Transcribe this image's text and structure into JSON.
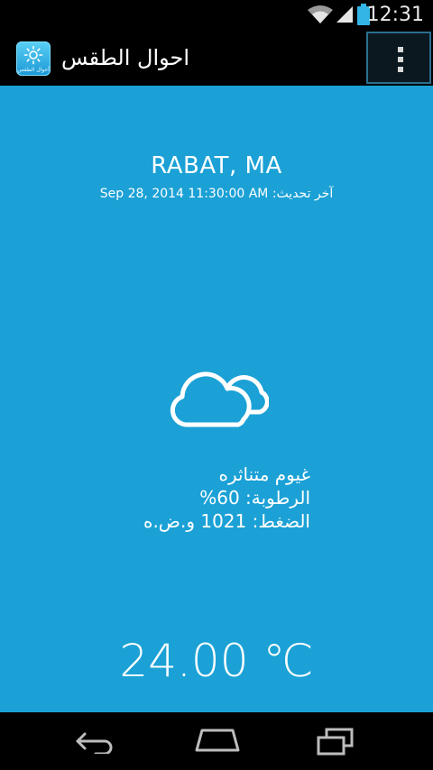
{
  "status_bar": {
    "time": "12:31",
    "icons": [
      "wifi-icon",
      "signal-icon",
      "battery-icon"
    ]
  },
  "action_bar": {
    "app_icon": "weather-app-icon",
    "app_icon_caption": "أحوال الطقس",
    "title": "احوال الطقس",
    "overflow_icon": "overflow-menu-icon"
  },
  "weather": {
    "city": "RABAT, MA",
    "last_update_label": "آخر تحديث:",
    "last_update_value": "Sep 28, 2014 11:30:00 AM",
    "condition_icon": "cloudy-icon",
    "description": "غيوم متناثره",
    "humidity_label": "الرطوبة:",
    "humidity_value": "60%",
    "pressure_label": "الضغط:",
    "pressure_value": "1021",
    "pressure_unit": "و.ض.ه",
    "temperature": "24.00 ℃"
  },
  "nav_bar": {
    "icons": [
      "back-icon",
      "home-icon",
      "recent-apps-icon"
    ]
  },
  "colors": {
    "content_background": "#1ba1d6",
    "bar_background": "#000000",
    "text": "#ffffff"
  }
}
